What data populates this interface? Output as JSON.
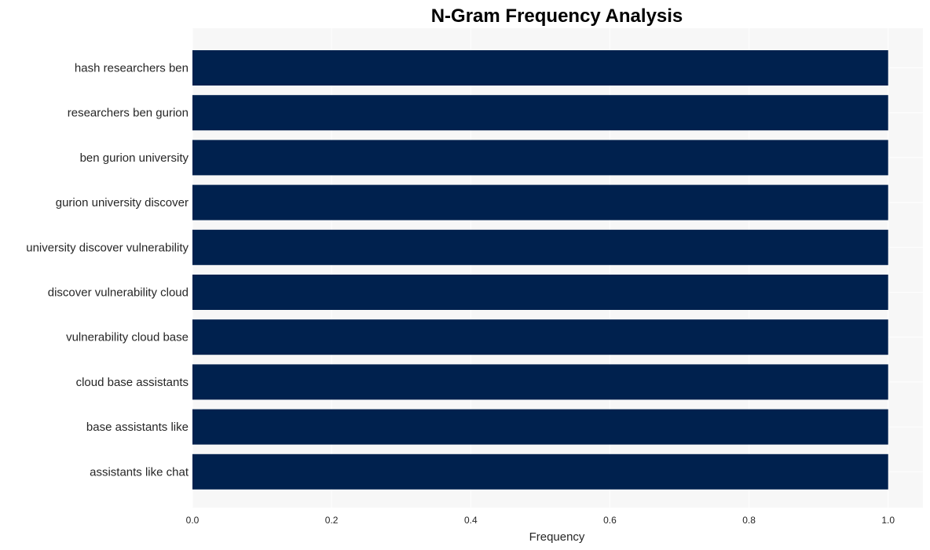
{
  "chart_data": {
    "type": "bar",
    "orientation": "horizontal",
    "title": "N-Gram Frequency Analysis",
    "xlabel": "Frequency",
    "ylabel": "",
    "categories": [
      "hash researchers ben",
      "researchers ben gurion",
      "ben gurion university",
      "gurion university discover",
      "university discover vulnerability",
      "discover vulnerability cloud",
      "vulnerability cloud base",
      "cloud base assistants",
      "base assistants like",
      "assistants like chat"
    ],
    "values": [
      1,
      1,
      1,
      1,
      1,
      1,
      1,
      1,
      1,
      1
    ],
    "xlim": [
      0,
      1.05
    ],
    "xticks": [
      "0.0",
      "0.2",
      "0.4",
      "0.6",
      "0.8",
      "1.0"
    ],
    "grid": true,
    "colors": {
      "bar": "#00214e",
      "plot_bg": "#f7f7f7",
      "grid": "#ffffff"
    }
  }
}
